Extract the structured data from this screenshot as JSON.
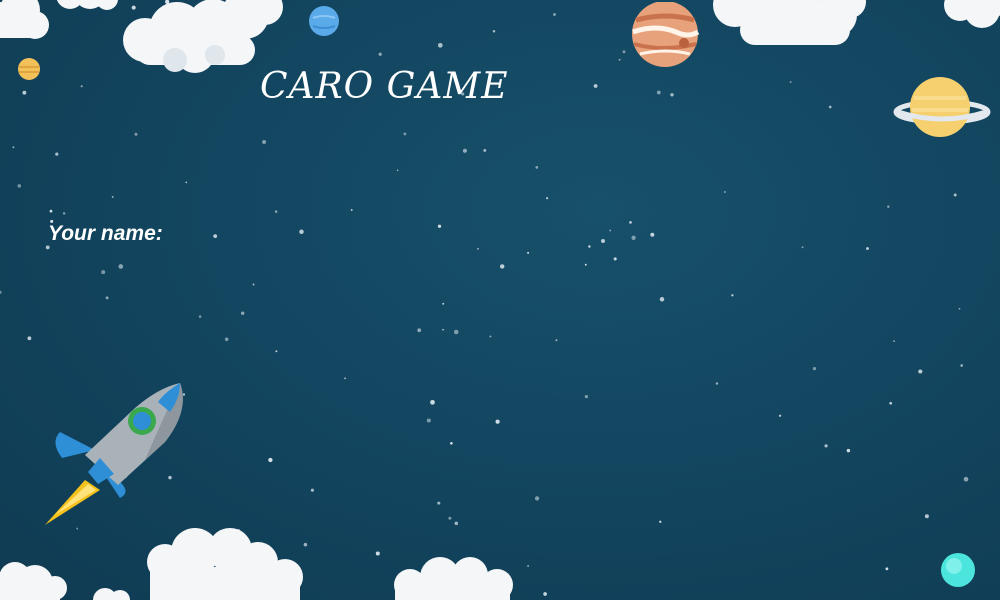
{
  "title": "CARO GAME",
  "name_label": "Your name:",
  "colors": {
    "background": "#134660",
    "cloud": "#ffffff",
    "star": "#d8e3ea",
    "rocket_body": "#9ea7ae",
    "rocket_fin": "#2f8fd6",
    "flame": "#f5c21b"
  },
  "decorations": [
    "cloud-icon",
    "planet-icon",
    "saturn-icon",
    "rocket-icon",
    "star-icon"
  ]
}
